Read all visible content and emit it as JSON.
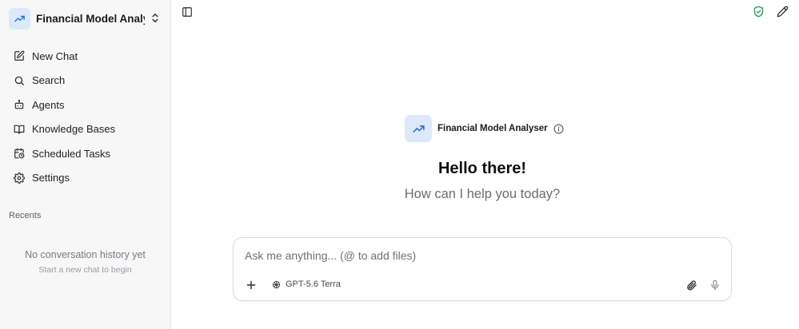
{
  "agent": {
    "name_truncated": "Financial Model Analy...",
    "name": "Financial Model Analyser"
  },
  "nav": {
    "items": [
      {
        "label": "New Chat",
        "icon": "edit-icon"
      },
      {
        "label": "Search",
        "icon": "search-icon"
      },
      {
        "label": "Agents",
        "icon": "robot-icon"
      },
      {
        "label": "Knowledge Bases",
        "icon": "book-icon"
      },
      {
        "label": "Scheduled Tasks",
        "icon": "calendar-clock-icon"
      },
      {
        "label": "Settings",
        "icon": "gear-icon"
      }
    ]
  },
  "recents": {
    "heading": "Recents",
    "empty_title": "No conversation history yet",
    "empty_subtitle": "Start a new chat to begin"
  },
  "main": {
    "greeting": "Hello there!",
    "subtitle": "How can I help you today?"
  },
  "composer": {
    "placeholder": "Ask me anything... (@ to add files)",
    "model": "GPT-5.6 Terra"
  },
  "colors": {
    "accent": "#2f6bd6",
    "avatar_bg": "#dbe9fb",
    "shield": "#2e9d5a",
    "sidebar_bg": "#f7f7f8"
  }
}
